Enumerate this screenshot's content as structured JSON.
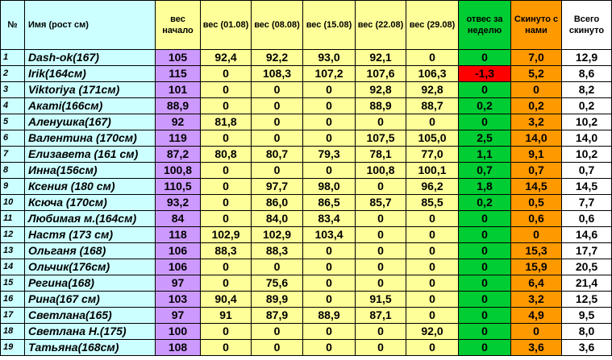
{
  "headers": [
    "№",
    "Имя (рост см)",
    "вес начало",
    "вес (01.08)",
    "вес (08.08)",
    "вес (15.08)",
    "вес (22.08)",
    "вес (29.08)",
    "отвес за неделю",
    "Скинуто с нами",
    "Всего скинуто"
  ],
  "colors": {
    "name_col": "#ccffff",
    "start_col": "#cc99ff",
    "weights": "#ffff99",
    "weekly": "#00cc33",
    "negative": "#ff0000",
    "ours": "#ff9900"
  },
  "rows": [
    {
      "n": "1",
      "name": "Dash-ok(167)",
      "start": "105",
      "w1": "92,4",
      "w2": "92,2",
      "w3": "93,0",
      "w4": "92,1",
      "w5": "0",
      "week": "0",
      "ours": "7,0",
      "total": "12,9",
      "week_neg": false
    },
    {
      "n": "2",
      "name": "Irik(164см)",
      "start": "115",
      "w1": "0",
      "w2": "108,3",
      "w3": "107,2",
      "w4": "107,6",
      "w5": "106,3",
      "week": "-1,3",
      "ours": "5,2",
      "total": "8,6",
      "week_neg": true
    },
    {
      "n": "3",
      "name": "Viktoriya (171см)",
      "start": "101",
      "w1": "0",
      "w2": "0",
      "w3": "0",
      "w4": "92,8",
      "w5": "92,8",
      "week": "0",
      "ours": "0",
      "total": "8,2",
      "week_neg": false
    },
    {
      "n": "4",
      "name": "Акаmi(166см)",
      "start": "88,9",
      "w1": "0",
      "w2": "0",
      "w3": "0",
      "w4": "88,9",
      "w5": "88,7",
      "week": "0,2",
      "ours": "0,2",
      "total": "0,2",
      "week_neg": false
    },
    {
      "n": "5",
      "name": "Аленушка(167)",
      "start": "92",
      "w1": "81,8",
      "w2": "0",
      "w3": "0",
      "w4": "0",
      "w5": "0",
      "week": "0",
      "ours": "3,2",
      "total": "10,2",
      "week_neg": false
    },
    {
      "n": "6",
      "name": "Валентина (170см)",
      "start": "119",
      "w1": "0",
      "w2": "0",
      "w3": "0",
      "w4": "107,5",
      "w5": "105,0",
      "week": "2,5",
      "ours": "14,0",
      "total": "14,0",
      "week_neg": false
    },
    {
      "n": "7",
      "name": "Елизавета (161 см)",
      "start": "87,2",
      "w1": "80,8",
      "w2": "80,7",
      "w3": "79,3",
      "w4": "78,1",
      "w5": "77,0",
      "week": "1,1",
      "ours": "9,1",
      "total": "10,2",
      "week_neg": false
    },
    {
      "n": "8",
      "name": "Инна(156см)",
      "start": "100,8",
      "w1": "0",
      "w2": "0",
      "w3": "0",
      "w4": "100,8",
      "w5": "100,1",
      "week": "0,7",
      "ours": "0,7",
      "total": "0,7",
      "week_neg": false
    },
    {
      "n": "9",
      "name": "Ксения (180 см)",
      "start": "110,5",
      "w1": "0",
      "w2": "97,7",
      "w3": "98,0",
      "w4": "0",
      "w5": "96,2",
      "week": "1,8",
      "ours": "14,5",
      "total": "14,5",
      "week_neg": false
    },
    {
      "n": "10",
      "name": "Ксюча (170см)",
      "start": "93,2",
      "w1": "0",
      "w2": "86,0",
      "w3": "86,5",
      "w4": "85,7",
      "w5": "85,5",
      "week": "0,2",
      "ours": "0,5",
      "total": "7,7",
      "week_neg": false
    },
    {
      "n": "11",
      "name": "Любимая м.(164см)",
      "start": "84",
      "w1": "0",
      "w2": "84,0",
      "w3": "83,4",
      "w4": "0",
      "w5": "0",
      "week": "0",
      "ours": "0,6",
      "total": "0,6",
      "week_neg": false
    },
    {
      "n": "12",
      "name": "Настя (173 см)",
      "start": "118",
      "w1": "102,9",
      "w2": "102,9",
      "w3": "103,4",
      "w4": "0",
      "w5": "0",
      "week": "0",
      "ours": "0",
      "total": "14,6",
      "week_neg": false
    },
    {
      "n": "13",
      "name": "Ольганя (168)",
      "start": "106",
      "w1": "88,3",
      "w2": "88,3",
      "w3": "0",
      "w4": "0",
      "w5": "0",
      "week": "0",
      "ours": "15,3",
      "total": "17,7",
      "week_neg": false
    },
    {
      "n": "14",
      "name": "Ольчик(176см)",
      "start": "106",
      "w1": "0",
      "w2": "0",
      "w3": "0",
      "w4": "0",
      "w5": "0",
      "week": "0",
      "ours": "15,9",
      "total": "20,5",
      "week_neg": false
    },
    {
      "n": "15",
      "name": "Регина(168)",
      "start": "97",
      "w1": "0",
      "w2": "75,6",
      "w3": "0",
      "w4": "0",
      "w5": "0",
      "week": "0",
      "ours": "6,4",
      "total": "21,4",
      "week_neg": false
    },
    {
      "n": "16",
      "name": "Рина(167 см)",
      "start": "103",
      "w1": "90,4",
      "w2": "89,9",
      "w3": "0",
      "w4": "91,5",
      "w5": "0",
      "week": "0",
      "ours": "3,2",
      "total": "12,5",
      "week_neg": false
    },
    {
      "n": "17",
      "name": "Светлана(165)",
      "start": "97",
      "w1": "91",
      "w2": "87,9",
      "w3": "88,9",
      "w4": "87,1",
      "w5": "0",
      "week": "0",
      "ours": "4,9",
      "total": "9,5",
      "week_neg": false
    },
    {
      "n": "18",
      "name": "Светлана Н.(175)",
      "start": "100",
      "w1": "0",
      "w2": "0",
      "w3": "0",
      "w4": "0",
      "w5": "92,0",
      "week": "0",
      "ours": "0",
      "total": "8,0",
      "week_neg": false
    },
    {
      "n": "19",
      "name": "Татьяна(168см)",
      "start": "108",
      "w1": "0",
      "w2": "0",
      "w3": "0",
      "w4": "0",
      "w5": "0",
      "week": "0",
      "ours": "3,6",
      "total": "3,6",
      "week_neg": false
    }
  ]
}
